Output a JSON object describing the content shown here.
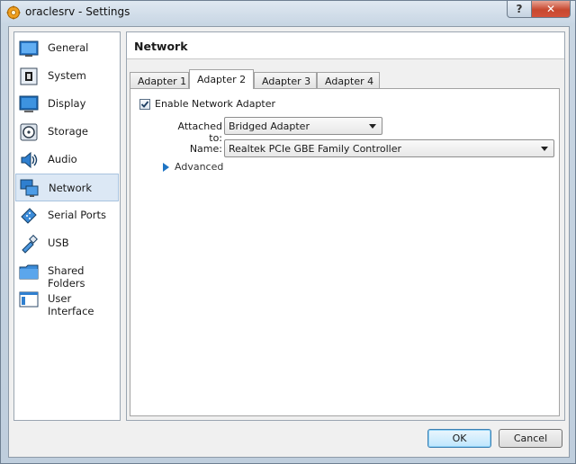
{
  "window": {
    "title": "oraclesrv - Settings",
    "help_glyph": "?",
    "close_glyph": "✕"
  },
  "sidebar": {
    "items": [
      {
        "label": "General",
        "icon": "general-icon"
      },
      {
        "label": "System",
        "icon": "system-icon"
      },
      {
        "label": "Display",
        "icon": "display-icon"
      },
      {
        "label": "Storage",
        "icon": "storage-icon"
      },
      {
        "label": "Audio",
        "icon": "audio-icon"
      },
      {
        "label": "Network",
        "icon": "network-icon",
        "selected": true
      },
      {
        "label": "Serial Ports",
        "icon": "serial-ports-icon"
      },
      {
        "label": "USB",
        "icon": "usb-icon"
      },
      {
        "label": "Shared Folders",
        "icon": "shared-folders-icon"
      },
      {
        "label": "User Interface",
        "icon": "user-interface-icon"
      }
    ]
  },
  "page": {
    "title": "Network",
    "tabs": [
      {
        "label": "Adapter 1"
      },
      {
        "label": "Adapter 2",
        "active": true
      },
      {
        "label": "Adapter 3"
      },
      {
        "label": "Adapter 4"
      }
    ],
    "enable_label": "Enable Network Adapter",
    "enable_checked": true,
    "attached_label": "Attached to:",
    "attached_value": "Bridged Adapter",
    "name_label": "Name:",
    "name_value": "Realtek PCIe GBE Family Controller",
    "advanced_label": "Advanced"
  },
  "buttons": {
    "ok": "OK",
    "cancel": "Cancel"
  },
  "colors": {
    "selection_bg": "#dce8f5",
    "accent": "#1e74c4",
    "close_red": "#c7482f"
  }
}
